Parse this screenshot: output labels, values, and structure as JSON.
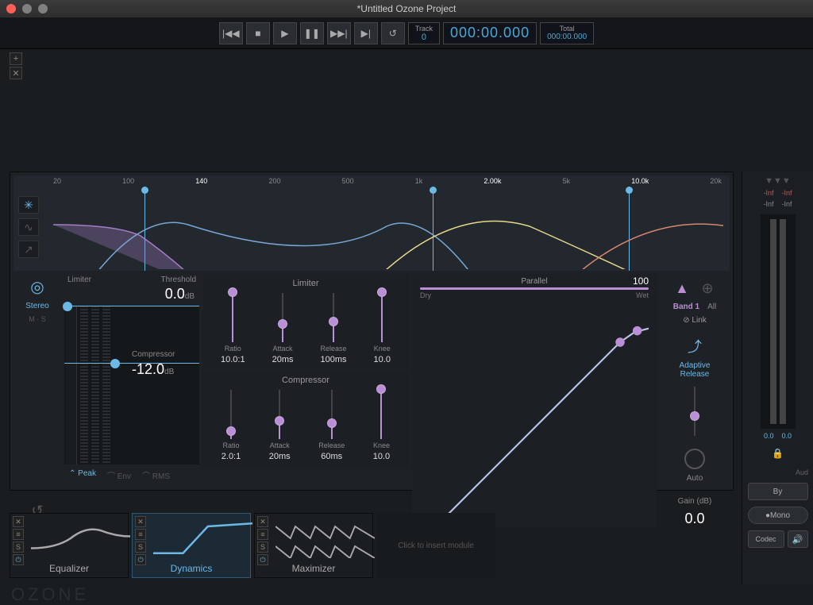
{
  "window": {
    "title": "*Untitled Ozone Project"
  },
  "transport": {
    "track_label": "Track",
    "track_value": "0",
    "time": "000:00.000",
    "total_label": "Total",
    "total_value": "000:00.000"
  },
  "spectrum": {
    "labels": [
      "20",
      "100",
      "140",
      "200",
      "500",
      "1k",
      "2.00k",
      "5k",
      "10.0k",
      "20k"
    ],
    "crossovers": [
      "140",
      "2.00k",
      "10.0k"
    ]
  },
  "dynamics": {
    "stereo_label": "Stereo",
    "ms_label": "M · S",
    "limiter_label": "Limiter",
    "threshold_label": "Threshold",
    "limiter_value": "0.0",
    "limiter_unit": "dB",
    "compressor_label": "Compressor",
    "compressor_value": "-12.0",
    "compressor_unit": "dB",
    "detect": {
      "peak": "Peak",
      "env": "Env",
      "rms": "RMS"
    },
    "limiter_controls": {
      "title": "Limiter",
      "ratio": {
        "label": "Ratio",
        "value": "10.0:1",
        "pos": 0.95
      },
      "attack": {
        "label": "Attack",
        "value": "20ms",
        "pos": 0.3
      },
      "release": {
        "label": "Release",
        "value": "100ms",
        "pos": 0.35
      },
      "knee": {
        "label": "Knee",
        "value": "10.0",
        "pos": 0.95
      }
    },
    "comp_controls": {
      "title": "Compressor",
      "ratio": {
        "label": "Ratio",
        "value": "2.0:1",
        "pos": 0.1
      },
      "attack": {
        "label": "Attack",
        "value": "20ms",
        "pos": 0.3
      },
      "release": {
        "label": "Release",
        "value": "60ms",
        "pos": 0.25
      },
      "knee": {
        "label": "Knee",
        "value": "10.0",
        "pos": 0.95
      }
    },
    "parallel": {
      "label": "Parallel",
      "value": "100",
      "dry": "Dry",
      "wet": "Wet"
    },
    "band": {
      "band1": "Band 1",
      "all": "All",
      "link": "Link"
    },
    "adaptive": "Adaptive\nRelease",
    "auto": "Auto",
    "gain_label": "Gain (dB)",
    "gain_value": "0.0"
  },
  "modules": {
    "eq": "Equalizer",
    "dyn": "Dynamics",
    "max": "Maximizer",
    "empty": "Click to insert module"
  },
  "meters": {
    "inf": "-Inf",
    "val": "0.0",
    "aud": "Aud",
    "bypass": "By",
    "mono": "Mono",
    "codec": "Codec"
  },
  "brand": "OZONE"
}
